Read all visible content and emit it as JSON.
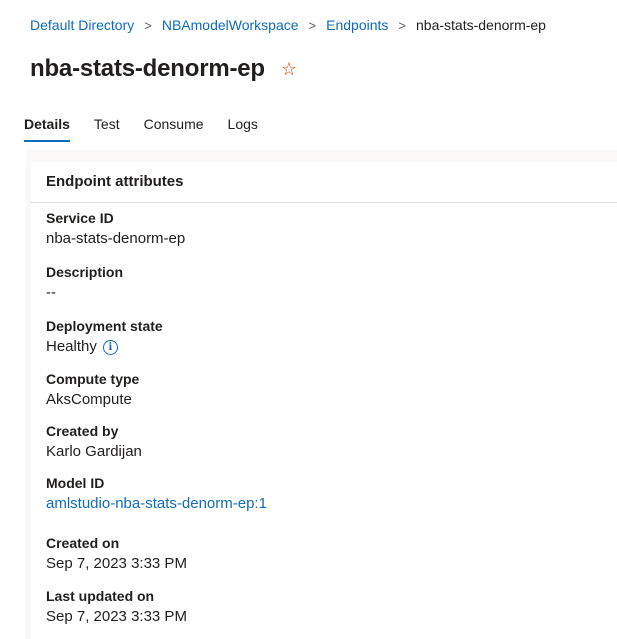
{
  "breadcrumb": {
    "items": [
      "Default Directory",
      "NBAmodelWorkspace",
      "Endpoints"
    ],
    "current": "nba-stats-denorm-ep",
    "separator": ">"
  },
  "page": {
    "title": "nba-stats-denorm-ep",
    "favorite_icon": "star-icon",
    "favorite_glyph": "☆"
  },
  "tabs": [
    {
      "label": "Details",
      "active": true
    },
    {
      "label": "Test",
      "active": false
    },
    {
      "label": "Consume",
      "active": false
    },
    {
      "label": "Logs",
      "active": false
    }
  ],
  "card": {
    "title": "Endpoint attributes",
    "attributes": [
      {
        "label": "Service ID",
        "value": "nba-stats-denorm-ep"
      },
      {
        "label": "Description",
        "value": "--"
      },
      {
        "label": "Deployment state",
        "value": "Healthy",
        "icon": "info-icon",
        "icon_glyph": "i"
      },
      {
        "label": "Compute type",
        "value": "AksCompute"
      },
      {
        "label": "Created by",
        "value": "Karlo Gardijan"
      },
      {
        "label": "Model ID",
        "value": "amlstudio-nba-stats-denorm-ep:1",
        "link": true
      },
      {
        "label": "Created on",
        "value": "Sep 7, 2023 3:33 PM"
      },
      {
        "label": "Last updated on",
        "value": "Sep 7, 2023 3:33 PM"
      }
    ]
  },
  "colors": {
    "link": "#0f6cbd",
    "text": "#201f1e",
    "star": "#d83b01",
    "divider": "#e1dfdd"
  }
}
